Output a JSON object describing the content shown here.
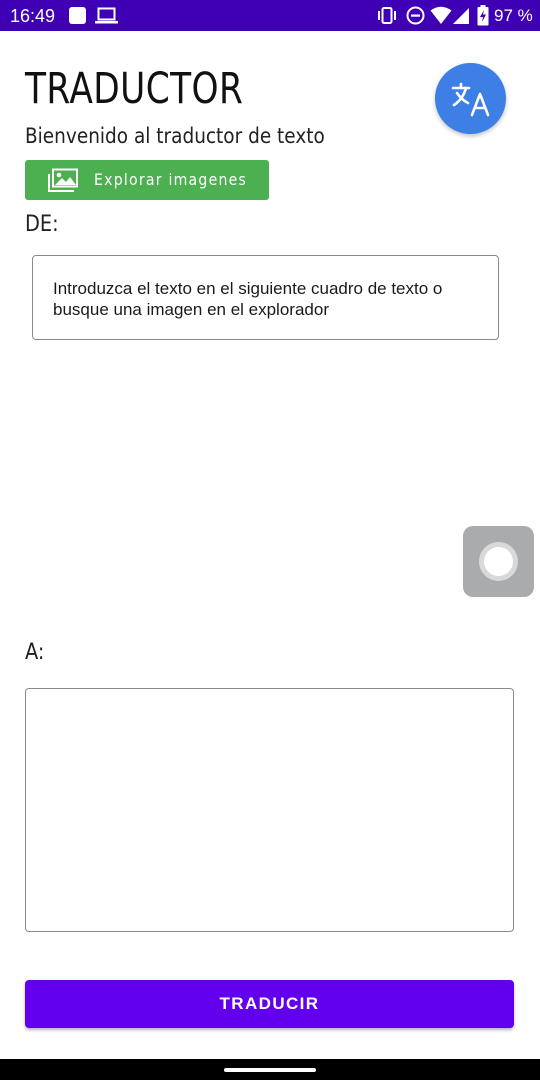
{
  "status_bar": {
    "time": "16:49",
    "battery": "97 %",
    "icons": [
      "notification-square-icon",
      "laptop-icon",
      "vibrate-icon",
      "do-not-disturb-icon",
      "wifi-icon",
      "signal-icon",
      "battery-charging-icon"
    ]
  },
  "header": {
    "title": "TRADUCTOR",
    "subtitle": "Bienvenido al traductor de texto",
    "logo_icon": "translate-icon",
    "logo_color": "#3e7fe6"
  },
  "explore": {
    "label": "Explorar imagenes",
    "icon": "images-icon",
    "color": "#4caf50"
  },
  "source": {
    "label": "DE:",
    "placeholder": "Introduzca el texto en el siguiente cuadro de texto o busque una imagen en el explorador"
  },
  "target": {
    "label": "A:",
    "value": ""
  },
  "action": {
    "translate_label": "TRADUCIR",
    "color": "#6200ee"
  },
  "colors": {
    "status_bar": "#3f00b5",
    "nav_bar": "#000000"
  }
}
